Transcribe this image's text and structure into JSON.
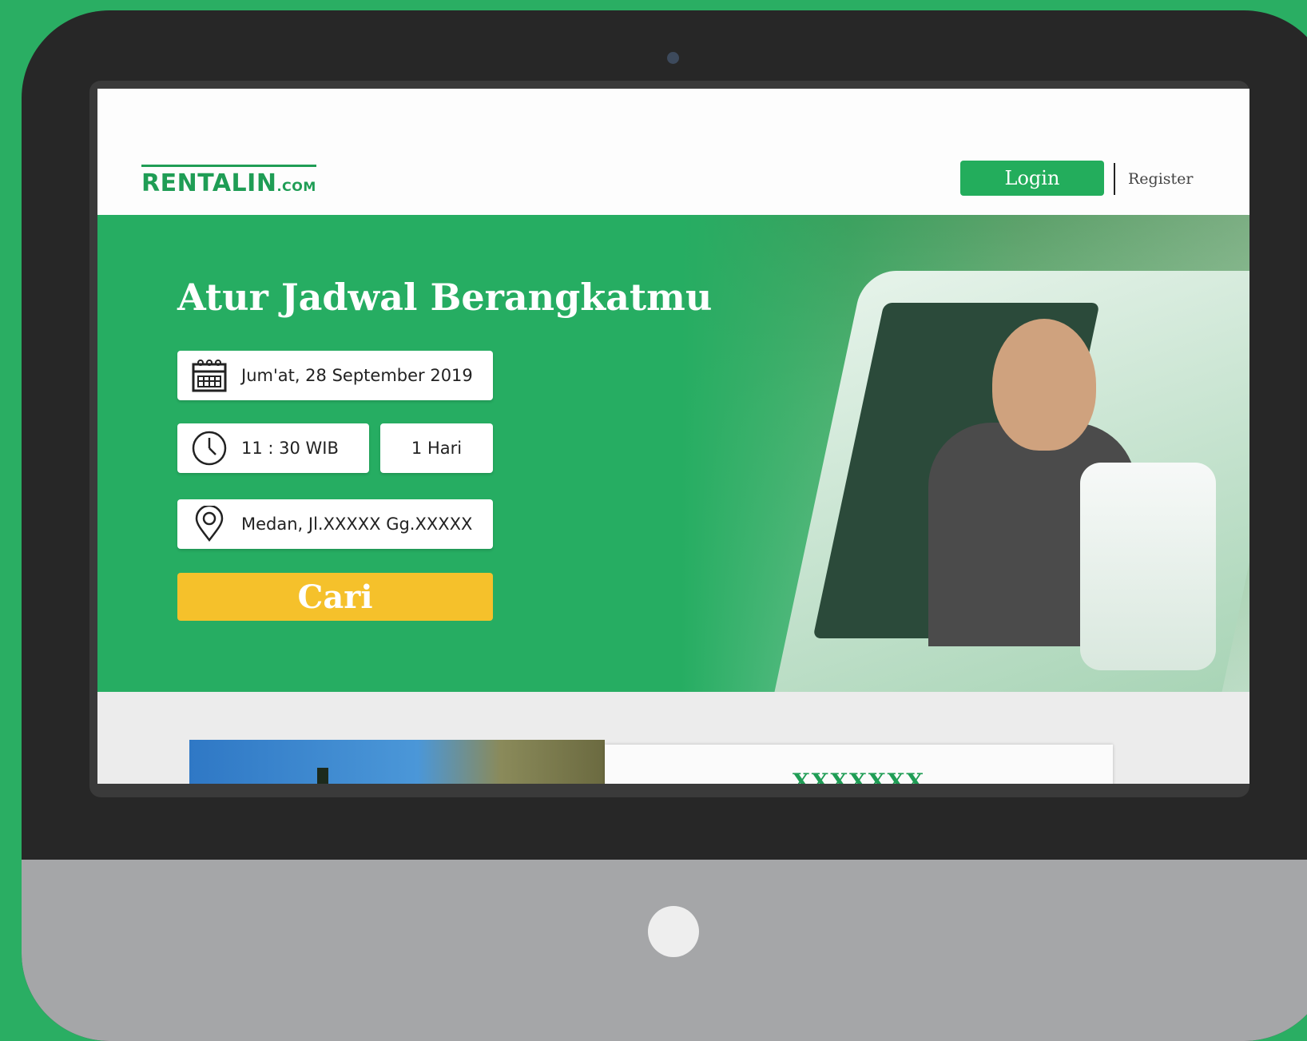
{
  "header": {
    "logo_main": "RENTALIN",
    "logo_tld": ".COM",
    "login_label": "Login",
    "register_label": "Register"
  },
  "hero": {
    "title": "Atur Jadwal Berangkatmu",
    "date_value": "Jum'at, 28 September 2019",
    "time_value": "11 : 30  WIB",
    "duration_value": "1 Hari",
    "location_value": "Medan, Jl.XXXXX Gg.XXXXX",
    "search_label": "Cari"
  },
  "content": {
    "card_heading": "XXXXXXX"
  },
  "colors": {
    "brand_green": "#26ad62",
    "accent_yellow": "#f5c12b",
    "device_body": "#272727",
    "device_chin": "#a5a6a8"
  },
  "icons": {
    "date": "calendar-icon",
    "time": "clock-icon",
    "location": "location-pin-icon"
  }
}
